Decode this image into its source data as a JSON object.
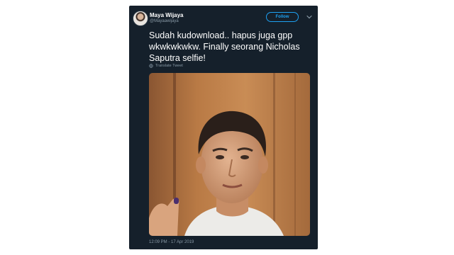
{
  "tweet": {
    "author_name": "Maya Wijaya",
    "author_handle": "@Mayaawijaya",
    "follow_label": "Follow",
    "text": "Sudah kudownload.. hapus juga gpp wkwkwkwkw. Finally seorang Nicholas Saputra selfie!",
    "translate_label": "Translate Tweet",
    "timestamp": "12:09 PM - 17 Apr 2019",
    "icons": {
      "avatar": "avatar",
      "menu": "chevron-down-icon",
      "translate": "globe-icon"
    },
    "colors": {
      "background": "#15202b",
      "accent": "#1da1f2",
      "secondary_text": "#8899a6"
    }
  }
}
